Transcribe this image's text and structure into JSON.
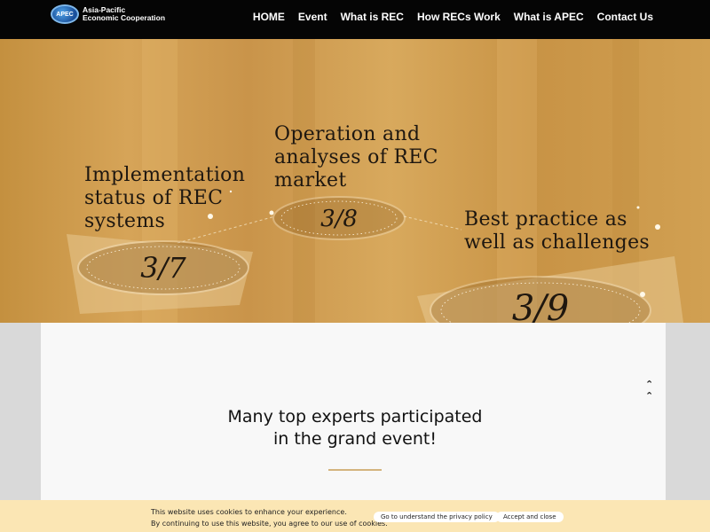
{
  "header": {
    "logo_mark": "APEC",
    "logo_line1": "Asia-Pacific",
    "logo_line2": "Economic Cooperation",
    "nav": [
      "HOME",
      "Event",
      "What is REC",
      "How RECs Work",
      "What is APEC",
      "Contact Us"
    ]
  },
  "hero": {
    "items": [
      {
        "title": "Implementation\nstatus of REC\nsystems",
        "date": "3/7"
      },
      {
        "title": "Operation and\nanalyses of REC\nmarket",
        "date": "3/8"
      },
      {
        "title": "Best practice as\nwell as challenges",
        "date": "3/9"
      }
    ]
  },
  "main": {
    "scroll_icon": "double-chevron-up-icon",
    "headline": "Many top experts participated\nin the grand event!"
  },
  "cookie": {
    "text": "This website uses cookies to enhance your experience.\nBy continuing to use this website, you agree to our use of cookies.",
    "policy_button": "Go to understand the privacy policy",
    "accept_button": "Accept and close"
  }
}
